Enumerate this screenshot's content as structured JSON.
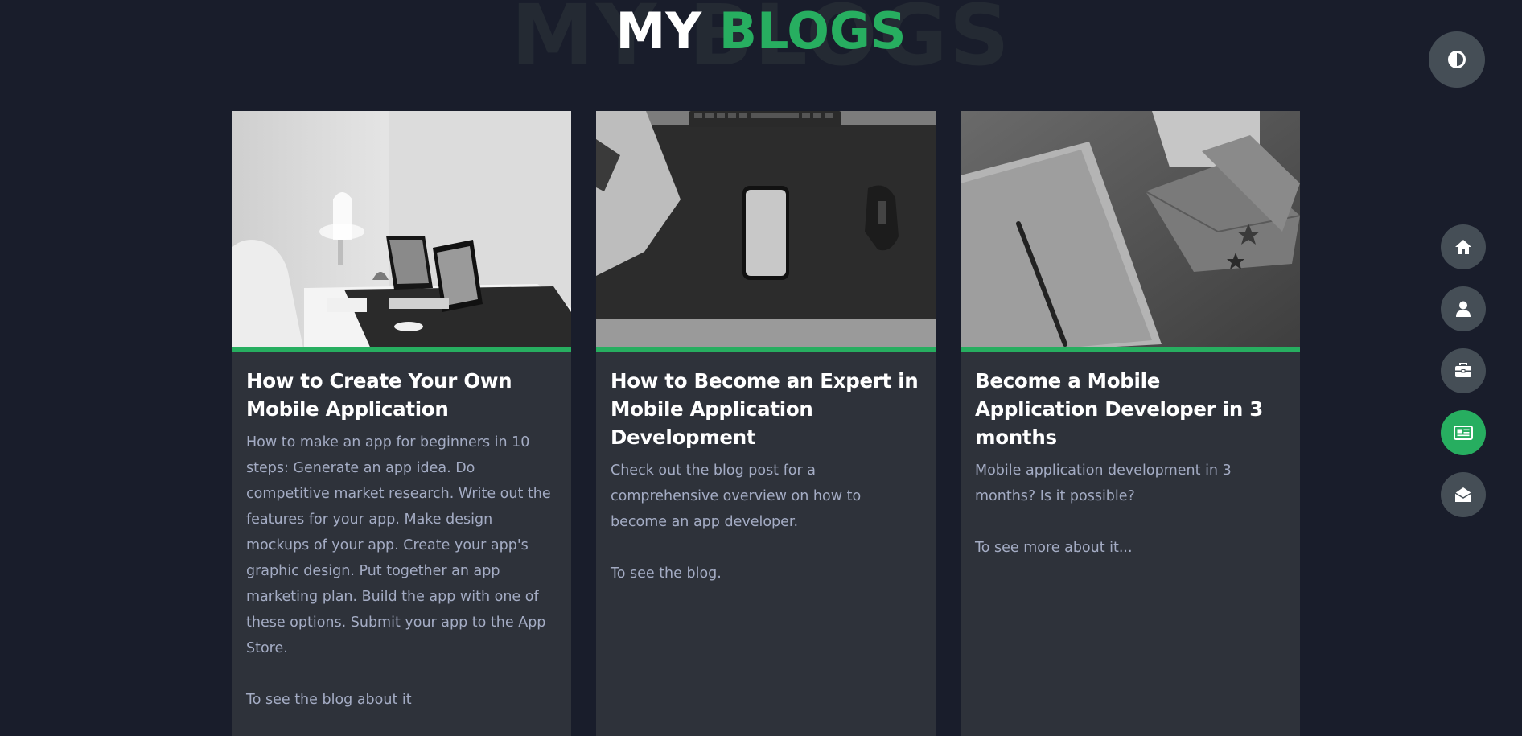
{
  "heading": {
    "background_text": "MY BLOGS",
    "word1": "MY ",
    "word2": "BLOGS"
  },
  "theme_toggle": {
    "icon": "contrast-icon"
  },
  "side_nav": {
    "items": [
      {
        "icon": "home-icon",
        "active": false
      },
      {
        "icon": "user-icon",
        "active": false
      },
      {
        "icon": "briefcase-icon",
        "active": false
      },
      {
        "icon": "newspaper-icon",
        "active": true
      },
      {
        "icon": "envelope-open-icon",
        "active": false
      }
    ]
  },
  "blogs": [
    {
      "image": "desk-with-tablets-photo",
      "title": "How to Create Your Own Mobile Application",
      "text": "How to make an app for beginners in 10 steps: Generate an app idea. Do competitive market research. Write out the features for your app. Make design mockups of your app. Create your app's graphic design. Put together an app marketing plan. Build the app with one of these options. Submit your app to the App Store.",
      "link": "To see the blog about it"
    },
    {
      "image": "phone-on-desk-mat-photo",
      "title": "How to Become an Expert in Mobile Application Development",
      "text": "Check out the blog post for a comprehensive overview on how to become an app developer.",
      "link": "To see the blog."
    },
    {
      "image": "notebook-and-envelopes-photo",
      "title": "Become a Mobile Application Developer in 3 months",
      "text": "Mobile application development in 3 months? Is it possible?",
      "link": "To see more about it..."
    }
  ],
  "colors": {
    "background": "#191d2b",
    "accent": "#27ae60",
    "card": "#2e323a",
    "button": "#454e56",
    "text_muted": "#a4acc4"
  }
}
